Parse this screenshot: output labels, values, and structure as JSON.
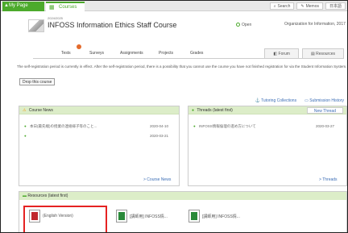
{
  "topbar": {
    "mypage_label": "My Page",
    "courses_label": "Courses",
    "search_label": "Search",
    "memos_label": "Memos",
    "lang_label": "日本語"
  },
  "course": {
    "year": "2024/2025",
    "title": "INFOSS Information Ethics Staff Course",
    "status": "Open",
    "org": "Organization for Information, 2017"
  },
  "subnav": {
    "items": [
      "Tests",
      "Surveys",
      "Assignments",
      "Projects",
      "Grades"
    ],
    "forum_label": "Forum",
    "resources_label": "Resources"
  },
  "notice": {
    "text": "The self-registration period is currently in effect. After the self-registration period, there is a possibility that you cannot use the course you have not finished registration for via the Student Information System.",
    "drop_label": "Drop this course"
  },
  "links": {
    "tutoring": "Tutoring Collections",
    "submission": "Submission History"
  },
  "course_news": {
    "title": "Course News",
    "rows": [
      {
        "text": "本日(最先端)の授業の連絡様子等のこと...",
        "date": "2020-04-10"
      },
      {
        "text": "",
        "date": "2020-03-21"
      }
    ],
    "more": "> Course News"
  },
  "threads": {
    "title": "Threads (latest first)",
    "new_thread": "New Thread",
    "rows": [
      {
        "text": "INFOSS情報倫理の進め方について",
        "date": "2020-03-27"
      }
    ],
    "more": "> Threads"
  },
  "resources": {
    "title": "Resources (latest first)",
    "items": [
      {
        "label": "(English Version)"
      },
      {
        "label": "[講師用] INFOSS情..."
      },
      {
        "label": "[講師用] INFOSS情..."
      }
    ]
  },
  "colors": {
    "accent": "#4caa2c",
    "highlight": "#e52222"
  }
}
